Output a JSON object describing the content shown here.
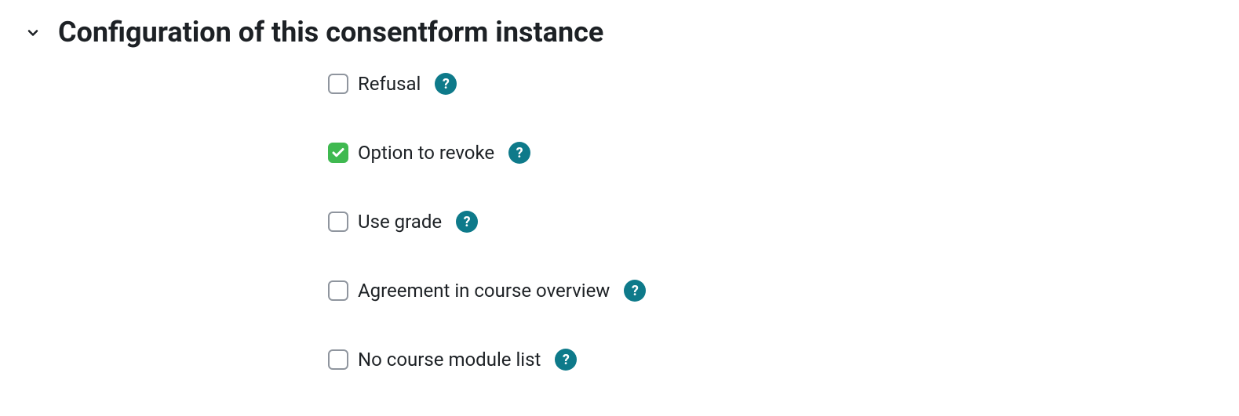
{
  "section": {
    "title": "Configuration of this consentform instance",
    "options": [
      {
        "key": "refusal",
        "label": "Refusal",
        "checked": false
      },
      {
        "key": "option-to-revoke",
        "label": "Option to revoke",
        "checked": true
      },
      {
        "key": "use-grade",
        "label": "Use grade",
        "checked": false
      },
      {
        "key": "agreement-in-course-overview",
        "label": "Agreement in course overview",
        "checked": false
      },
      {
        "key": "no-course-module-list",
        "label": "No course module list",
        "checked": false
      }
    ]
  },
  "help_glyph": "?"
}
